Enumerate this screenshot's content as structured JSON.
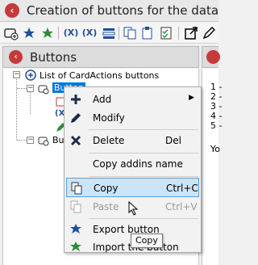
{
  "window": {
    "title": "Creation of buttons for the data"
  },
  "toolbar": {
    "icons": [
      "add-button-icon",
      "export-icon",
      "import-icon",
      "fx-icon",
      "fx-free-icon",
      "list-icon",
      "copy-icon",
      "paste-icon",
      "checklist-icon",
      "open-external-icon",
      "edit-icon"
    ],
    "fx_label": "(X)",
    "fx_free_label": "(X)"
  },
  "panel": {
    "title": "Buttons"
  },
  "tree": {
    "root_label": "List of CardActions buttons",
    "selected_label": "Button",
    "second_label": "Bu"
  },
  "right_pane": {
    "lines": [
      "1 -",
      "2 -",
      "3 -",
      "4 -",
      "5 -"
    ],
    "bottom_label": "Yo"
  },
  "context_menu": {
    "items": [
      {
        "label": "Add",
        "shortcut": "",
        "icon": "plus-icon",
        "submenu": true,
        "disabled": false
      },
      {
        "label": "Modify",
        "shortcut": "",
        "icon": "pencil-icon",
        "submenu": false,
        "disabled": false
      },
      {
        "label": "Delete",
        "shortcut": "Del",
        "icon": "x-icon",
        "submenu": false,
        "disabled": false
      },
      {
        "label": "Copy addins name",
        "shortcut": "",
        "icon": "",
        "submenu": false,
        "disabled": false
      },
      {
        "label": "Copy",
        "shortcut": "Ctrl+C",
        "icon": "copy-icon",
        "submenu": false,
        "disabled": false
      },
      {
        "label": "Paste",
        "shortcut": "Ctrl+V",
        "icon": "paste-icon",
        "submenu": false,
        "disabled": true
      },
      {
        "label": "Export button",
        "shortcut": "",
        "icon": "export-icon",
        "submenu": false,
        "disabled": false
      },
      {
        "label": "Import the button",
        "shortcut": "",
        "icon": "import-icon",
        "submenu": false,
        "disabled": false
      }
    ]
  },
  "tooltip": {
    "text": "Copy"
  },
  "colors": {
    "accent": "#0078d7",
    "close_red": "#c63a3a",
    "highlight": "#cce4f7"
  }
}
